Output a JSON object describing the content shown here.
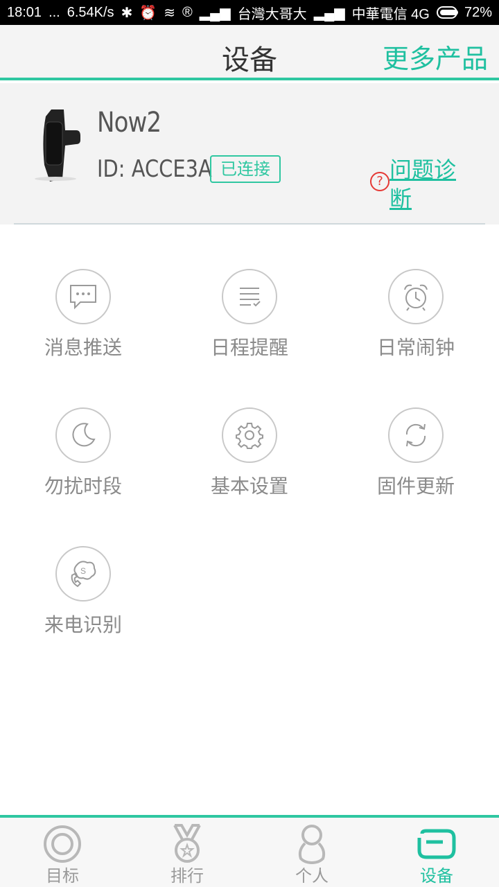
{
  "status_bar": {
    "time": "18:01",
    "dots": "...",
    "speed": "6.54K/s",
    "carrier1": "台灣大哥大",
    "carrier2": "中華電信 4G",
    "battery": "72%"
  },
  "header": {
    "title": "设备",
    "more_products": "更多产品"
  },
  "device": {
    "name": "Now2",
    "id_text": "ID: ACCE3A",
    "status_badge": "已连接",
    "diagnose_link": "问题诊断"
  },
  "features": [
    {
      "label": "消息推送",
      "icon": "message-icon"
    },
    {
      "label": "日程提醒",
      "icon": "schedule-icon"
    },
    {
      "label": "日常闹钟",
      "icon": "alarm-clock-icon"
    },
    {
      "label": "勿扰时段",
      "icon": "moon-icon"
    },
    {
      "label": "基本设置",
      "icon": "gear-icon"
    },
    {
      "label": "固件更新",
      "icon": "refresh-icon"
    },
    {
      "label": "来电识别",
      "icon": "phone-icon"
    }
  ],
  "bottom_nav": [
    {
      "label": "目标",
      "icon": "target-icon",
      "active": false
    },
    {
      "label": "排行",
      "icon": "medal-icon",
      "active": false
    },
    {
      "label": "个人",
      "icon": "person-icon",
      "active": false
    },
    {
      "label": "设备",
      "icon": "band-icon",
      "active": true
    }
  ],
  "colors": {
    "accent": "#2fc7a1",
    "diagnose_icon": "#e53935"
  }
}
